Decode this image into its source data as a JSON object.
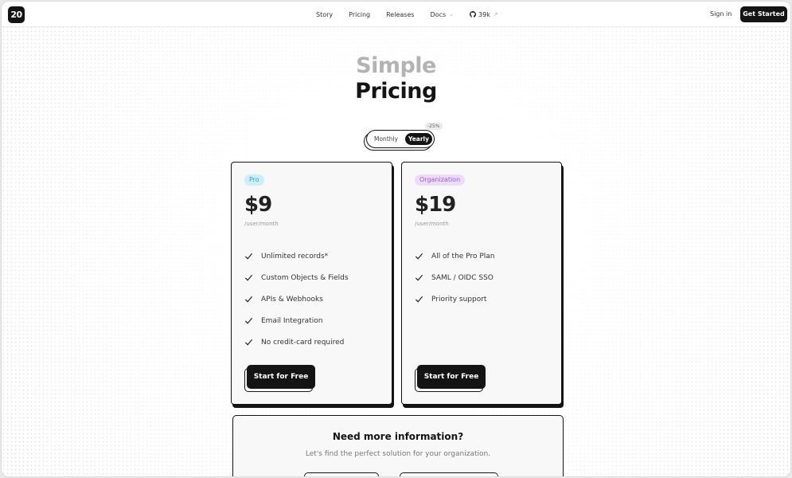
{
  "nav": {
    "logo_text": "20",
    "links": [
      {
        "label": "Story"
      },
      {
        "label": "Pricing"
      },
      {
        "label": "Releases"
      },
      {
        "label": "Docs"
      }
    ],
    "github_stars": "39k",
    "signin_label": "Sign in",
    "get_started_label": "Get Started"
  },
  "hero": {
    "line1": "Simple",
    "line2": "Pricing"
  },
  "billing_toggle": {
    "monthly_label": "Monthly",
    "yearly_label": "Yearly",
    "selected": "Yearly",
    "discount": "-25%"
  },
  "plans": [
    {
      "badge": "Pro",
      "price": "$9",
      "period": "/user/month",
      "features": [
        "Unlimited records*",
        "Custom Objects & Fields",
        "APIs & Webhooks",
        "Email Integration",
        "No credit-card required"
      ],
      "cta": "Start for Free"
    },
    {
      "badge": "Organization",
      "price": "$19",
      "period": "/user/month",
      "features": [
        "All of the Pro Plan",
        "SAML / OIDC SSO",
        "Priority support"
      ],
      "cta": "Start for Free"
    }
  ],
  "info": {
    "title": "Need more information?",
    "subtitle": "Let's find the perfect solution for your organization."
  },
  "colors": {
    "primary": "#141414",
    "pro_badge_bg": "#cdeefb",
    "pro_badge_text": "#3c9fd1",
    "org_badge_bg": "#ecdcfa",
    "org_badge_text": "#9b58d9"
  }
}
